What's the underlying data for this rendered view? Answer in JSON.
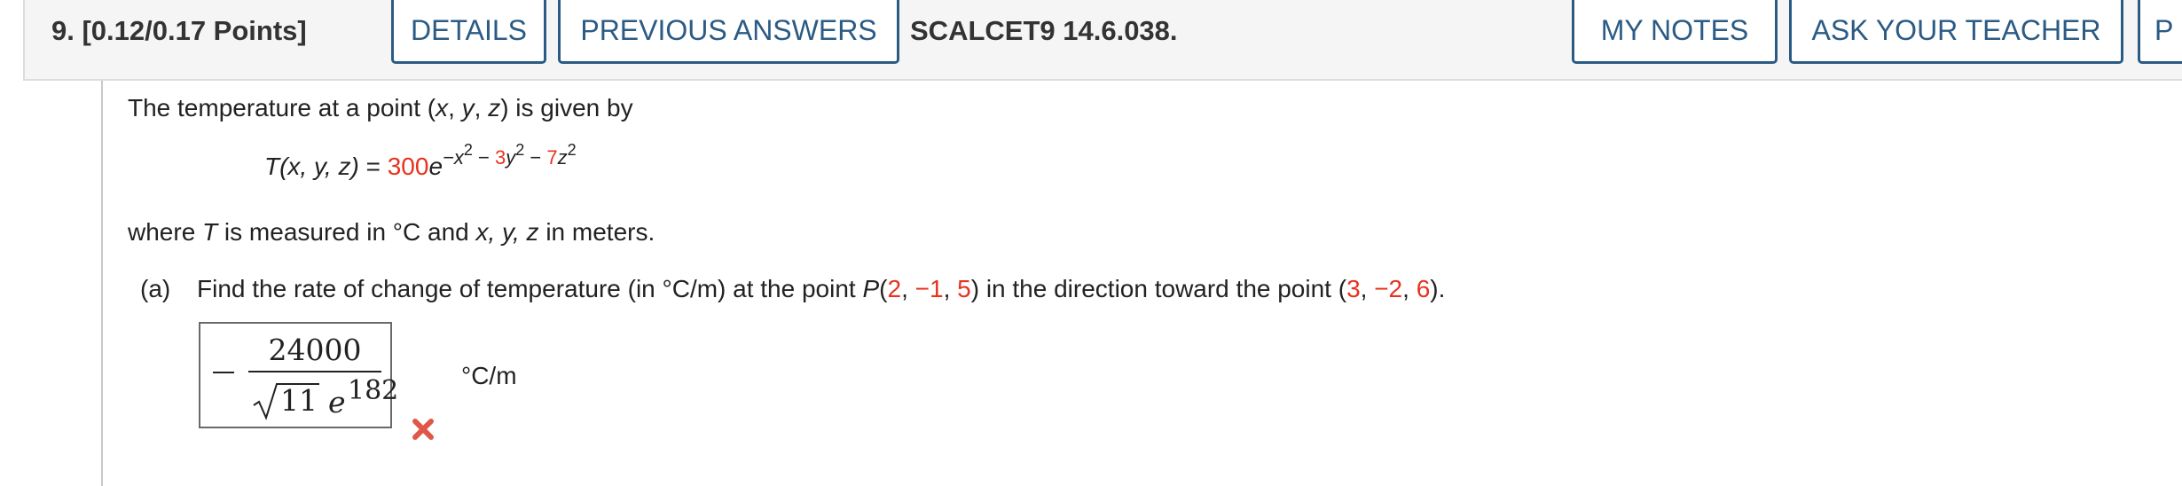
{
  "header": {
    "question_label": "9. [0.12/0.17 Points]",
    "tabs": {
      "details": "DETAILS",
      "previous_answers": "PREVIOUS ANSWERS",
      "my_notes": "MY NOTES",
      "ask_teacher": "ASK YOUR TEACHER",
      "partial": "P"
    },
    "source_ref": "SCALCET9 14.6.038."
  },
  "problem": {
    "intro_a": "The temperature at a point (",
    "intro_x": "x",
    "intro_c1": ", ",
    "intro_y": "y",
    "intro_c2": ", ",
    "intro_z": "z",
    "intro_b": ") is given by",
    "formula": {
      "T": "T",
      "lhs_args": "(x, y, z)",
      "equals": " = ",
      "coef": "300",
      "e": "e",
      "exp_minus": "−x",
      "exp_sq1": "2",
      "exp_sep1": " − ",
      "coef_y": "3",
      "exp_y": "y",
      "exp_sq2": "2",
      "exp_sep2": " − ",
      "coef_z": "7",
      "exp_z": "z",
      "exp_sq3": "2"
    },
    "where_a": "where ",
    "where_T": "T",
    "where_b": " is measured in °C and ",
    "where_vars": "x, y, z",
    "where_c": " in meters.",
    "part_a": {
      "label": "(a)",
      "text_1": "Find the rate of change of temperature (in °C/m) at the point ",
      "P": "P",
      "p_open": "(",
      "p1": "2",
      "p_sep1": ", ",
      "p2": "−1",
      "p_sep2": ", ",
      "p3": "5",
      "p_close": ")",
      "text_2": " in the direction toward the point (",
      "q1": "3",
      "q_sep1": ", ",
      "q2": "−2",
      "q_sep2": ", ",
      "q3": "6",
      "q_close": ").",
      "answer": {
        "numerator": "24000",
        "radicand": "11",
        "e": "e",
        "exponent": "182"
      },
      "units": "°C/m",
      "status_icon": "incorrect-x-icon"
    }
  },
  "colors": {
    "accent_blue": "#2b5b84",
    "highlight_red": "#e8321e",
    "header_bg": "#f5f5f5"
  }
}
